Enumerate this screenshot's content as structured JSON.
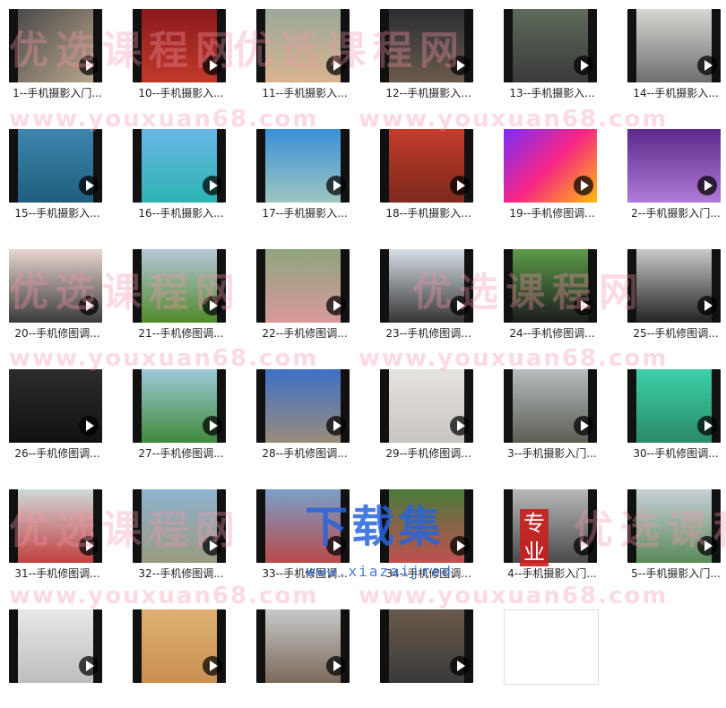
{
  "files": [
    {
      "label": "1--手机摄影入门...",
      "bg": "linear-gradient(135deg,#4a4a4a,#b9a58a)"
    },
    {
      "label": "10--手机摄影入...",
      "bg": "linear-gradient(180deg,#8b1a1a,#c0392b)"
    },
    {
      "label": "11--手机摄影入...",
      "bg": "linear-gradient(180deg,#9aa89a,#d8b48f)"
    },
    {
      "label": "12--手机摄影入...",
      "bg": "linear-gradient(180deg,#2a2e33,#6b5a4c)"
    },
    {
      "label": "13--手机摄影入...",
      "bg": "linear-gradient(180deg,#5e6b5a,#3a3a3a)"
    },
    {
      "label": "14--手机摄影入...",
      "bg": "linear-gradient(180deg,#d9d7d2,#6e6e6e)"
    },
    {
      "label": "15--手机摄影入...",
      "bg": "linear-gradient(180deg,#3d87b0,#1f5d7c)"
    },
    {
      "label": "16--手机摄影入...",
      "bg": "linear-gradient(180deg,#6bb6e8,#2bb3b1)"
    },
    {
      "label": "17--手机摄影入...",
      "bg": "linear-gradient(180deg,#3a8fd8,#9fc6c0)"
    },
    {
      "label": "18--手机摄影入...",
      "bg": "linear-gradient(180deg,#c53b2c,#7a2a1d)"
    },
    {
      "label": "19--手机修图调...",
      "bg": "linear-gradient(135deg,#7b2ff7,#f72585,#ffbe0b)",
      "square": true
    },
    {
      "label": "2--手机摄影入门...",
      "bg": "linear-gradient(180deg,#5a2a8a,#b07ad8)",
      "square": true
    },
    {
      "label": "20--手机修图调...",
      "bg": "linear-gradient(180deg,#e8d6cf,#3a3a3a)",
      "square": true
    },
    {
      "label": "21--手机修图调...",
      "bg": "linear-gradient(180deg,#b6c7d8,#4f8a2a)"
    },
    {
      "label": "22--手机修图调...",
      "bg": "linear-gradient(180deg,#8fa47f,#d89a9a)"
    },
    {
      "label": "23--手机修图调...",
      "bg": "linear-gradient(180deg,#d7e0e8,#333)"
    },
    {
      "label": "24--手机修图调...",
      "bg": "linear-gradient(180deg,#5d9b4a,#1c1c1c)"
    },
    {
      "label": "25--手机修图调...",
      "bg": "linear-gradient(180deg,#c9c9c9,#222)"
    },
    {
      "label": "26--手机修图调...",
      "bg": "linear-gradient(180deg,#2c2c2c,#111)",
      "square": true
    },
    {
      "label": "27--手机修图调...",
      "bg": "linear-gradient(180deg,#9fc9d8,#3f8a3a)"
    },
    {
      "label": "28--手机修图调...",
      "bg": "linear-gradient(180deg,#3f6fc8,#9a8c7a)"
    },
    {
      "label": "29--手机修图调...",
      "bg": "linear-gradient(180deg,#e6e3df,#c8c4bf)"
    },
    {
      "label": "3--手机摄影入门...",
      "bg": "linear-gradient(180deg,#b8bcc0,#5a5e52)"
    },
    {
      "label": "30--手机修图调...",
      "bg": "linear-gradient(180deg,#3bd1a8,#2a8a6a)"
    },
    {
      "label": "31--手机修图调...",
      "bg": "linear-gradient(180deg,#cfd8d8,#c04040)"
    },
    {
      "label": "32--手机修图调...",
      "bg": "linear-gradient(180deg,#8fb4d0,#9a9a80)"
    },
    {
      "label": "33--手机修图调...",
      "bg": "linear-gradient(180deg,#7aa0c8,#b84a4a)"
    },
    {
      "label": "34--手机修图调...",
      "bg": "linear-gradient(180deg,#4a7a3a,#c05050)"
    },
    {
      "label": "4--手机摄影入门...",
      "bg": "linear-gradient(180deg,#b8b8b8,#4a4a4a)"
    },
    {
      "label": "5--手机摄影入门...",
      "bg": "linear-gradient(180deg,#c8d0d8,#5a8a5a)"
    },
    {
      "label": "",
      "bg": "linear-gradient(180deg,#e8e8e8,#bdbdbd)"
    },
    {
      "label": "",
      "bg": "linear-gradient(180deg,#e0b070,#c89050)"
    },
    {
      "label": "",
      "bg": "linear-gradient(180deg,#c8c8c8,#7a6a5a)"
    },
    {
      "label": "",
      "bg": "linear-gradient(180deg,#6a5a4a,#3a3a3a)"
    },
    {
      "label": "",
      "bg": "#ffffff",
      "placeholder": true
    }
  ],
  "watermark": {
    "cn": "优选课程网",
    "url": "www.youxuan68.com",
    "logo_text": "下载集",
    "logo_seal": "专业",
    "logo_url": "www.xiazaijred"
  }
}
